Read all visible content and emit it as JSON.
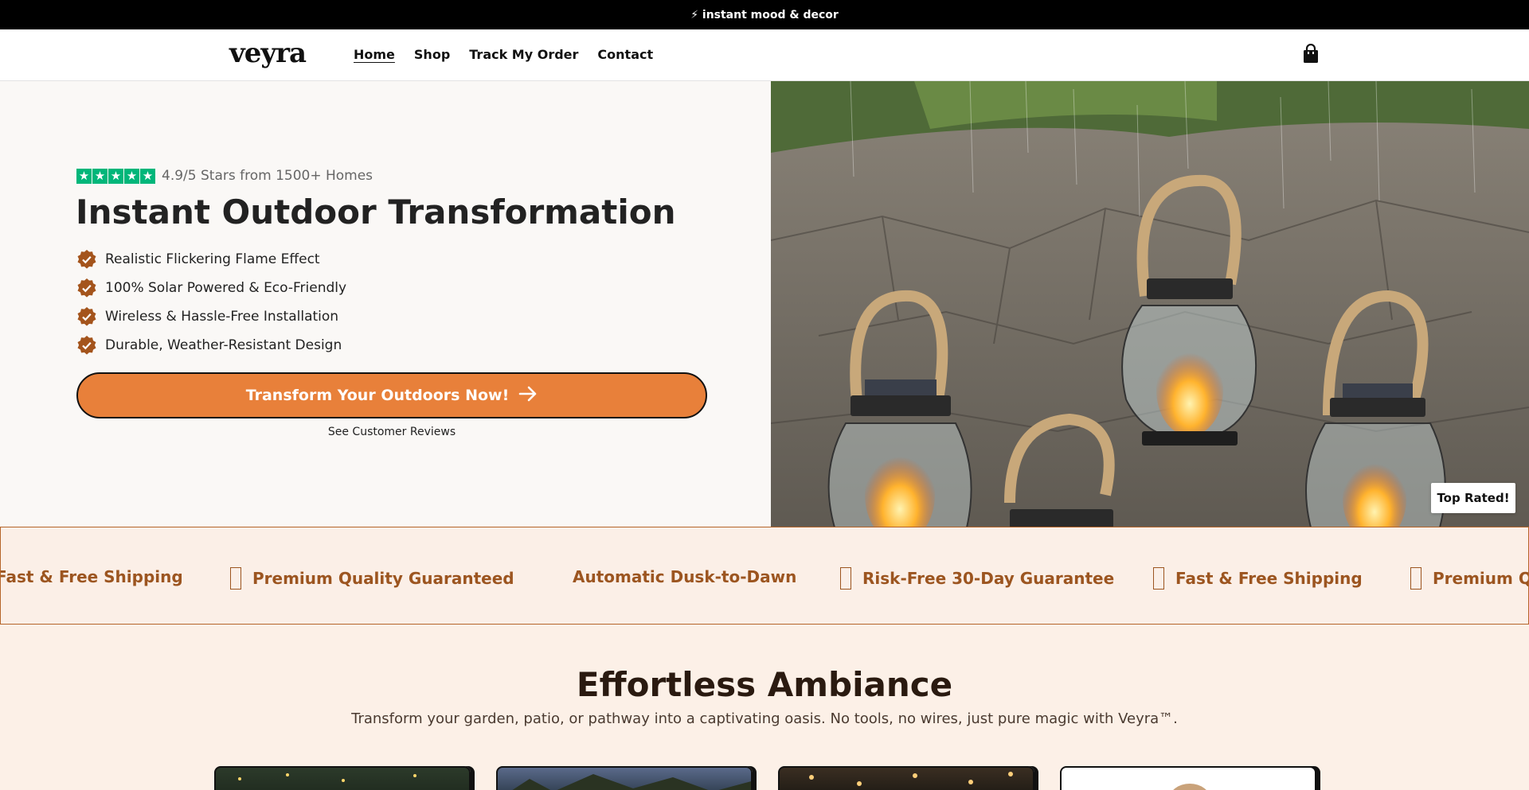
{
  "announcement": {
    "text": "⚡ instant mood & decor"
  },
  "header": {
    "logo": "veyra",
    "nav": [
      {
        "label": "Home",
        "active": true
      },
      {
        "label": "Shop"
      },
      {
        "label": "Track My Order"
      },
      {
        "label": "Contact"
      }
    ],
    "cart_icon": "shopping-bag-icon"
  },
  "hero": {
    "rating_text": "4.9/5 Stars from 1500+ Homes",
    "stars": 5,
    "title": "Instant Outdoor Transformation",
    "features": [
      "Realistic Flickering Flame Effect",
      "100% Solar Powered & Eco-Friendly",
      "Wireless & Hassle-Free Installation",
      "Durable, Weather-Resistant Design"
    ],
    "cta_label": "Transform Your Outdoors Now!",
    "reviews_link": "See Customer Reviews",
    "badge": "Top Rated!"
  },
  "ticker": {
    "items": [
      "Fast & Free Shipping",
      "Premium Quality Guaranteed",
      "Automatic Dusk-to-Dawn",
      "Risk-Free 30-Day Guarantee",
      "Fast & Free Shipping",
      "Premium Qu"
    ]
  },
  "ambiance": {
    "title": "Effortless Ambiance",
    "subtitle": "Transform your garden, patio, or pathway into a captivating oasis. No tools, no wires, just pure magic with Veyra™."
  },
  "colors": {
    "accent": "#e8803a",
    "check": "#a4541c",
    "ticker_text": "#9c5520",
    "trustpilot": "#00b67a"
  }
}
